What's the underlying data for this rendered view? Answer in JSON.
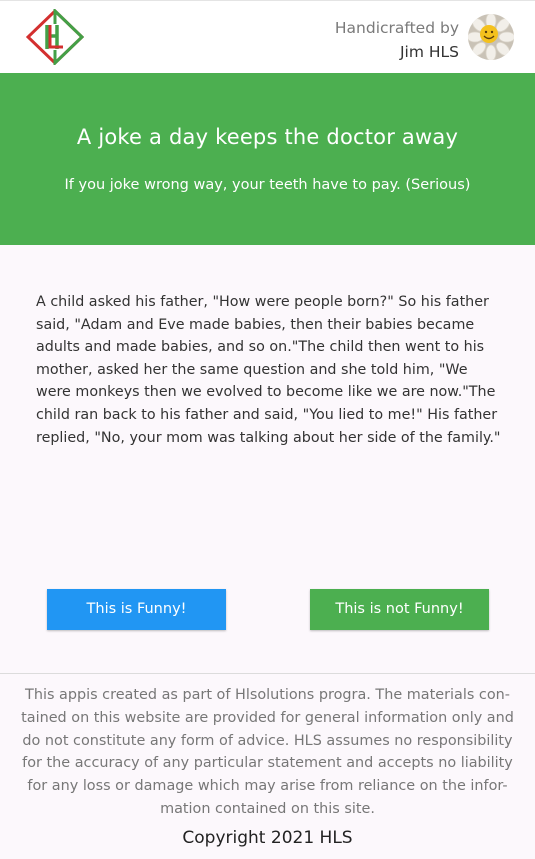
{
  "header": {
    "logo_text": "H",
    "credit_prefix": "Handicrafted by",
    "credit_name": "Jim HLS"
  },
  "hero": {
    "title": "A joke a day keeps the doctor away",
    "subtitle": "If you joke wrong way, your teeth have to pay. (Serious)",
    "background": "#4caf50"
  },
  "joke": {
    "text": "A child asked his father, \"How were people born?\" So his father said, \"Adam and Eve made babies, then their babies became adults and made babies, and so on.\"The child then went to his mother, asked her the same question and she told him, \"We were monkeys then we evolved to become like we are now.\"The child ran back to his father and said, \"You lied to me!\" His father replied, \"No, your mom was talking about her side of the family.\""
  },
  "buttons": {
    "funny_label": "This is Funny!",
    "funny_color": "#2196f3",
    "not_funny_label": "This is not Funny!",
    "not_funny_color": "#4caf50"
  },
  "footer": {
    "disclaimer": "This appis created as part of Hlsolutions progra. The materials con-tained on this website are provided for general information only and do not constitute any form of advice. HLS assumes no responsibility for the accuracy of any particular statement and accepts no liability for any loss or damage which may arise from reliance on the infor-mation contained on this site.",
    "copyright": "Copyright 2021 HLS"
  }
}
